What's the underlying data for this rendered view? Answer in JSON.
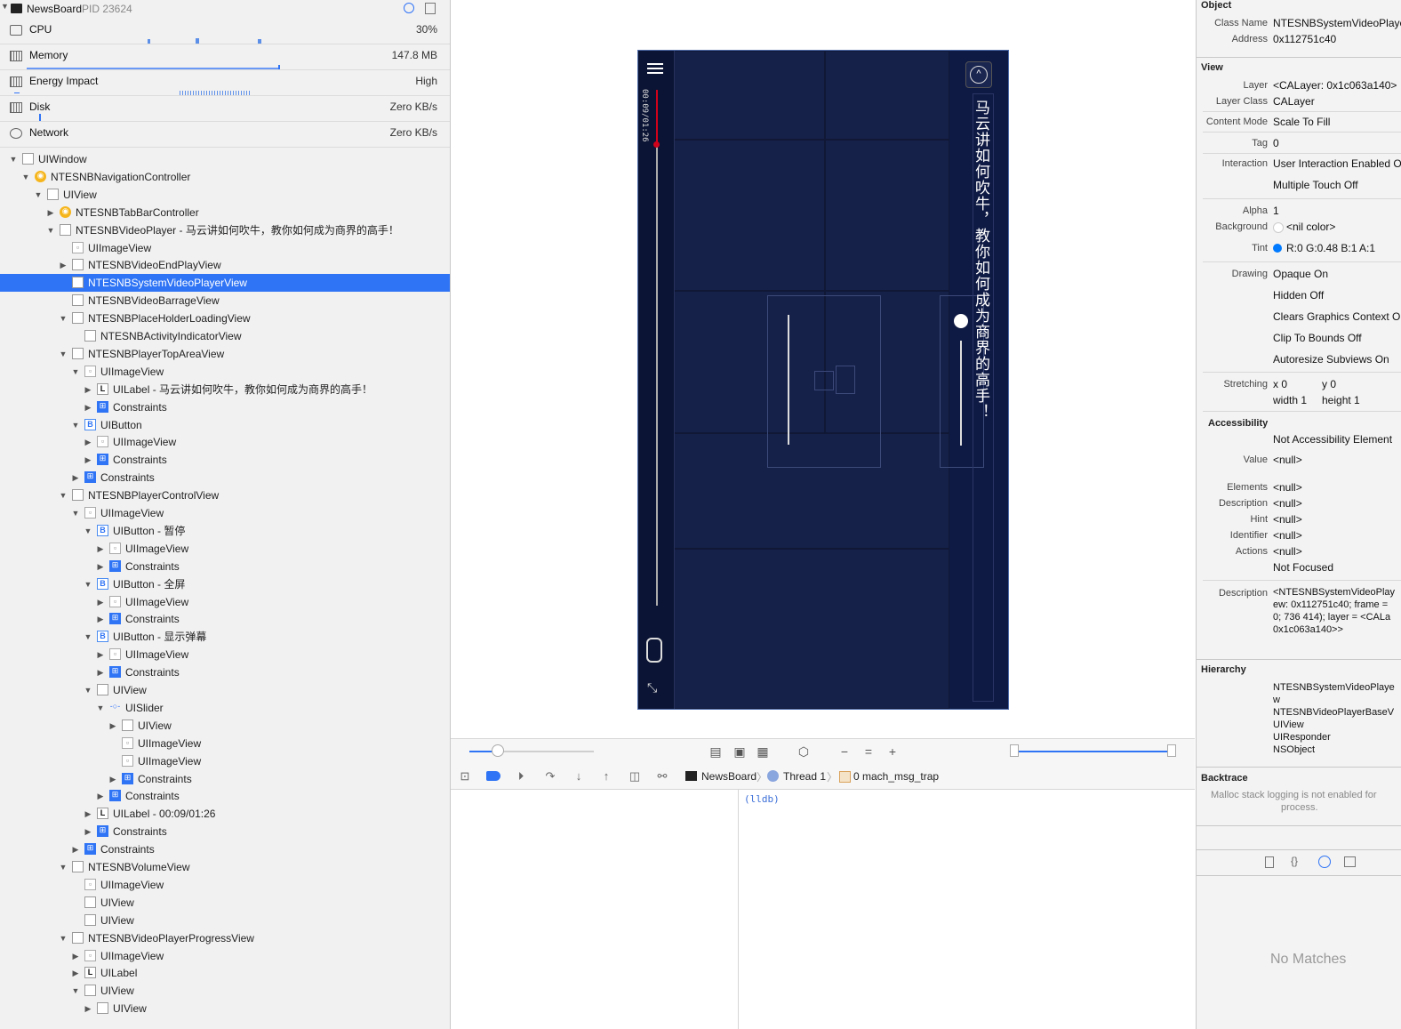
{
  "navigator": {
    "process": {
      "name": "NewsBoard",
      "pid": "PID 23624"
    },
    "gauges": [
      {
        "label": "CPU",
        "value": "30%"
      },
      {
        "label": "Memory",
        "value": "147.8 MB"
      },
      {
        "label": "Energy Impact",
        "value": "High"
      },
      {
        "label": "Disk",
        "value": "Zero KB/s"
      },
      {
        "label": "Network",
        "value": "Zero KB/s"
      }
    ],
    "tree": [
      {
        "depth": 0,
        "open": "down",
        "icon": "view",
        "label": "UIWindow"
      },
      {
        "depth": 1,
        "open": "down",
        "icon": "vc",
        "label": "NTESNBNavigationController"
      },
      {
        "depth": 2,
        "open": "down",
        "icon": "view",
        "label": "UIView"
      },
      {
        "depth": 3,
        "open": "right",
        "icon": "vc",
        "label": "NTESNBTabBarController"
      },
      {
        "depth": 3,
        "open": "down",
        "icon": "view",
        "label": "NTESNBVideoPlayer - 马云讲如何吹牛，教你如何成为商界的高手！"
      },
      {
        "depth": 4,
        "open": "",
        "icon": "img",
        "label": "UIImageView"
      },
      {
        "depth": 4,
        "open": "right",
        "icon": "view",
        "label": "NTESNBVideoEndPlayView"
      },
      {
        "depth": 4,
        "open": "",
        "icon": "view",
        "label": "NTESNBSystemVideoPlayerView",
        "selected": true
      },
      {
        "depth": 4,
        "open": "",
        "icon": "view",
        "label": "NTESNBVideoBarrageView"
      },
      {
        "depth": 4,
        "open": "down",
        "icon": "view",
        "label": "NTESNBPlaceHolderLoadingView"
      },
      {
        "depth": 5,
        "open": "",
        "icon": "view",
        "label": "NTESNBActivityIndicatorView"
      },
      {
        "depth": 4,
        "open": "down",
        "icon": "view",
        "label": "NTESNBPlayerTopAreaView"
      },
      {
        "depth": 5,
        "open": "down",
        "icon": "img",
        "label": "UIImageView"
      },
      {
        "depth": 6,
        "open": "right",
        "icon": "lbl",
        "label": "UILabel - 马云讲如何吹牛，教你如何成为商界的高手！"
      },
      {
        "depth": 6,
        "open": "right",
        "icon": "cons",
        "label": "Constraints"
      },
      {
        "depth": 5,
        "open": "down",
        "icon": "btn",
        "label": "UIButton"
      },
      {
        "depth": 6,
        "open": "right",
        "icon": "img",
        "label": "UIImageView"
      },
      {
        "depth": 6,
        "open": "right",
        "icon": "cons",
        "label": "Constraints"
      },
      {
        "depth": 5,
        "open": "right",
        "icon": "cons",
        "label": "Constraints"
      },
      {
        "depth": 4,
        "open": "down",
        "icon": "view",
        "label": "NTESNBPlayerControlView"
      },
      {
        "depth": 5,
        "open": "down",
        "icon": "img",
        "label": "UIImageView"
      },
      {
        "depth": 6,
        "open": "down",
        "icon": "btn",
        "label": "UIButton - 暂停"
      },
      {
        "depth": 7,
        "open": "right",
        "icon": "img",
        "label": "UIImageView"
      },
      {
        "depth": 7,
        "open": "right",
        "icon": "cons",
        "label": "Constraints"
      },
      {
        "depth": 6,
        "open": "down",
        "icon": "btn",
        "label": "UIButton - 全屏"
      },
      {
        "depth": 7,
        "open": "right",
        "icon": "img",
        "label": "UIImageView"
      },
      {
        "depth": 7,
        "open": "right",
        "icon": "cons",
        "label": "Constraints"
      },
      {
        "depth": 6,
        "open": "down",
        "icon": "btn",
        "label": "UIButton - 显示弹幕"
      },
      {
        "depth": 7,
        "open": "right",
        "icon": "img",
        "label": "UIImageView"
      },
      {
        "depth": 7,
        "open": "right",
        "icon": "cons",
        "label": "Constraints"
      },
      {
        "depth": 6,
        "open": "down",
        "icon": "view",
        "label": "UIView"
      },
      {
        "depth": 7,
        "open": "down",
        "icon": "sld",
        "label": "UISlider"
      },
      {
        "depth": 8,
        "open": "right",
        "icon": "view",
        "label": "UIView"
      },
      {
        "depth": 8,
        "open": "",
        "icon": "img",
        "label": "UIImageView"
      },
      {
        "depth": 8,
        "open": "",
        "icon": "img",
        "label": "UIImageView"
      },
      {
        "depth": 8,
        "open": "right",
        "icon": "cons",
        "label": "Constraints"
      },
      {
        "depth": 7,
        "open": "right",
        "icon": "cons",
        "label": "Constraints"
      },
      {
        "depth": 6,
        "open": "right",
        "icon": "lbl",
        "label": "UILabel - 00:09/01:26"
      },
      {
        "depth": 6,
        "open": "right",
        "icon": "cons",
        "label": "Constraints"
      },
      {
        "depth": 5,
        "open": "right",
        "icon": "cons",
        "label": "Constraints"
      },
      {
        "depth": 4,
        "open": "down",
        "icon": "view",
        "label": "NTESNBVolumeView"
      },
      {
        "depth": 5,
        "open": "",
        "icon": "img",
        "label": "UIImageView"
      },
      {
        "depth": 5,
        "open": "",
        "icon": "view",
        "label": "UIView"
      },
      {
        "depth": 5,
        "open": "",
        "icon": "view",
        "label": "UIView"
      },
      {
        "depth": 4,
        "open": "down",
        "icon": "view",
        "label": "NTESNBVideoPlayerProgressView"
      },
      {
        "depth": 5,
        "open": "right",
        "icon": "img",
        "label": "UIImageView"
      },
      {
        "depth": 5,
        "open": "right",
        "icon": "lbl",
        "label": "UILabel"
      },
      {
        "depth": 5,
        "open": "down",
        "icon": "view",
        "label": "UIView"
      },
      {
        "depth": 6,
        "open": "right",
        "icon": "view",
        "label": "UIView"
      }
    ]
  },
  "canvas": {
    "video_title": "马云讲如何吹牛，教你如何成为商界的高手！",
    "video_time": "00:09/01:26",
    "colors": {
      "video_bg": "#0f1a44",
      "selection": "#2f74f5"
    }
  },
  "debug_bar": {
    "crumbs": [
      "NewsBoard",
      "Thread 1",
      "0 mach_msg_trap"
    ]
  },
  "console": {
    "prompt": "(lldb)"
  },
  "inspector": {
    "object_header": "Object",
    "class_name_key": "Class Name",
    "class_name": "NTESNBSystemVideoPlaye",
    "address_key": "Address",
    "address": "0x112751c40",
    "view_header": "View",
    "layer_key": "Layer",
    "layer": "<CALayer: 0x1c063a140>",
    "layer_class_key": "Layer Class",
    "layer_class": "CALayer",
    "content_mode_key": "Content Mode",
    "content_mode": "Scale To Fill",
    "tag_key": "Tag",
    "tag": "0",
    "interaction_key": "Interaction",
    "interaction": "User Interaction Enabled O",
    "multi_touch": "Multiple Touch Off",
    "alpha_key": "Alpha",
    "alpha": "1",
    "background_key": "Background",
    "background": "<nil color>",
    "tint_key": "Tint",
    "tint": "R:0 G:0.48 B:1 A:1",
    "drawing_key": "Drawing",
    "drawing": [
      "Opaque On",
      "Hidden Off",
      "Clears Graphics Context O",
      "Clip To Bounds Off",
      "Autoresize Subviews On"
    ],
    "stretching_key": "Stretching",
    "stretch_x": "x 0",
    "stretch_y": "y 0",
    "stretch_w": "width 1",
    "stretch_h": "height 1",
    "accessibility_header": "Accessibility",
    "not_accessibility": "Not Accessibility Element",
    "value_key": "Value",
    "value": "<null>",
    "elements_key": "Elements",
    "elements": "<null>",
    "description_key": "Description",
    "description": "<null>",
    "hint_key": "Hint",
    "hint": "<null>",
    "identifier_key": "Identifier",
    "identifier": "<null>",
    "actions_key": "Actions",
    "actions": "<null>",
    "not_focused": "Not Focused",
    "desc2_key": "Description",
    "desc2": [
      "<NTESNBSystemVideoPlay",
      "ew: 0x112751c40; frame =",
      "0; 736 414); layer = <CALa",
      "0x1c063a140>>"
    ],
    "hierarchy_header": "Hierarchy",
    "hierarchy": [
      "NTESNBSystemVideoPlaye",
      "w",
      "NTESNBVideoPlayerBaseV",
      "UIView",
      "UIResponder",
      "NSObject"
    ],
    "backtrace_header": "Backtrace",
    "backtrace": [
      "Malloc stack logging is not enabled for",
      "process."
    ],
    "no_matches": "No Matches"
  }
}
